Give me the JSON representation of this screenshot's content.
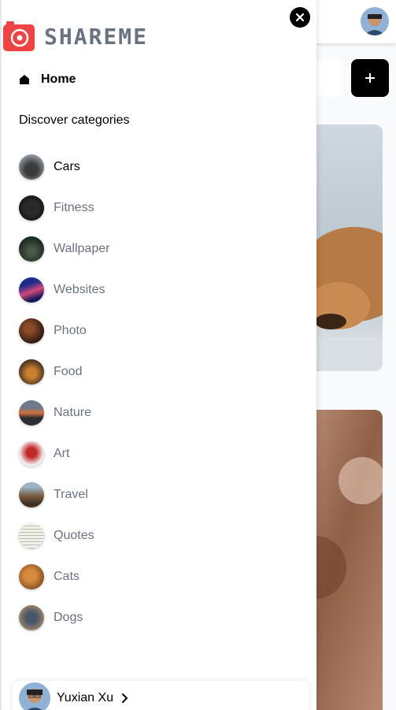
{
  "app": {
    "logo_text": "SHAREME",
    "logo_icon": "camera-icon"
  },
  "drawer": {
    "close_icon": "close-icon",
    "home": {
      "icon": "home-icon",
      "label": "Home"
    },
    "section_title": "Discover categories",
    "categories": [
      {
        "label": "Cars"
      },
      {
        "label": "Fitness"
      },
      {
        "label": "Wallpaper"
      },
      {
        "label": "Websites"
      },
      {
        "label": "Photo"
      },
      {
        "label": "Food"
      },
      {
        "label": "Nature"
      },
      {
        "label": "Art"
      },
      {
        "label": "Travel"
      },
      {
        "label": "Quotes"
      },
      {
        "label": "Cats"
      },
      {
        "label": "Dogs"
      }
    ],
    "user": {
      "name": "Yuxian Xu",
      "chevron_icon": "chevron-right-icon"
    }
  },
  "background": {
    "add_icon": "plus-icon"
  },
  "colors": {
    "brand": "#ef4444",
    "active_text": "#000000",
    "inactive_text": "#6b7280"
  }
}
